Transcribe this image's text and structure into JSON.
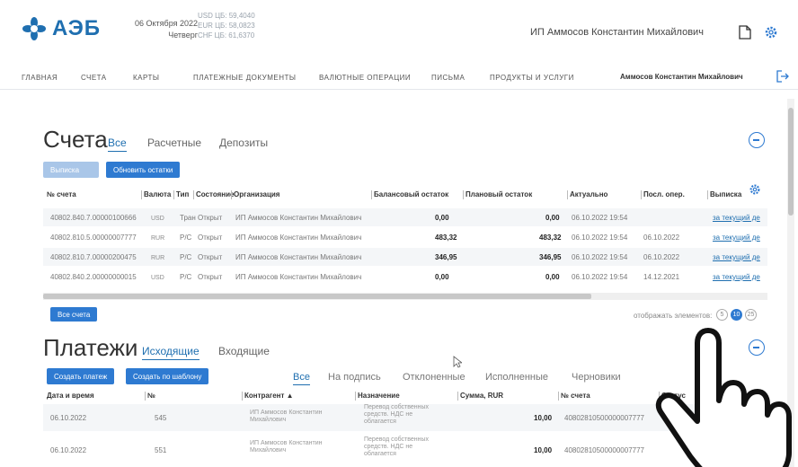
{
  "header": {
    "logo_text": "АЭБ",
    "date": "06 Октября 2022",
    "weekday": "Четверг",
    "rates": [
      "USD ЦБ: 59,4040",
      "EUR ЦБ: 58,0823",
      "CHF ЦБ: 61,6370"
    ],
    "user_name": "ИП Аммосов Константин Михайлович"
  },
  "nav": {
    "items": [
      "ГЛАВНАЯ",
      "СЧЕТА",
      "КАРТЫ",
      "ПЛАТЕЖНЫЕ ДОКУМЕНТЫ",
      "ВАЛЮТНЫЕ ОПЕРАЦИИ",
      "ПИСЬМА",
      "ПРОДУКТЫ И УСЛУГИ"
    ],
    "user_name": "Аммосов Константин Михайлович"
  },
  "accounts": {
    "title": "Счета",
    "tabs": [
      "Все",
      "Расчетные",
      "Депозиты"
    ],
    "buttons": {
      "first": "Выписка",
      "refresh": "Обновить остатки",
      "all": "Все счета"
    },
    "columns": [
      "№ счета",
      "Валюта",
      "Тип",
      "Состояние",
      "Организация",
      "Балансовый остаток",
      "Плановый остаток",
      "Актуально",
      "Посл. опер.",
      "Выписка"
    ],
    "rows": [
      {
        "number": "40802.840.7.00000100666",
        "currency": "USD",
        "type": "Тран",
        "state": "Открыт",
        "org": "ИП Аммосов Константин Михайлович",
        "balance": "0,00",
        "planned": "0,00",
        "actual": "06.10.2022 19:54",
        "last_op": "",
        "statement": "за текущий де"
      },
      {
        "number": "40802.810.5.00000007777",
        "currency": "RUR",
        "type": "Р/С",
        "state": "Открыт",
        "org": "ИП Аммосов Константин Михайлович",
        "balance": "483,32",
        "planned": "483,32",
        "actual": "06.10.2022 19:54",
        "last_op": "06.10.2022",
        "statement": "за текущий де"
      },
      {
        "number": "40802.810.7.00000200475",
        "currency": "RUR",
        "type": "Р/С",
        "state": "Открыт",
        "org": "ИП Аммосов Константин Михайлович",
        "balance": "346,95",
        "planned": "346,95",
        "actual": "06.10.2022 19:54",
        "last_op": "06.10.2022",
        "statement": "за текущий де"
      },
      {
        "number": "40802.840.2.00000000015",
        "currency": "USD",
        "type": "Р/С",
        "state": "Открыт",
        "org": "ИП Аммосов Константин Михайлович",
        "balance": "0,00",
        "planned": "0,00",
        "actual": "06.10.2022 19:54",
        "last_op": "14.12.2021",
        "statement": "за текущий де"
      }
    ],
    "show_label": "отображать элементов:",
    "page_sizes": [
      "5",
      "10",
      "25"
    ],
    "page_size_selected": "10"
  },
  "payments": {
    "title": "Платежи",
    "tabs": [
      "Исходящие",
      "Входящие"
    ],
    "buttons": {
      "create": "Создать платеж",
      "create_template": "Создать по шаблону"
    },
    "filters": [
      "Все",
      "На подпись",
      "Отклоненные",
      "Исполненные",
      "Черновики"
    ],
    "columns": [
      "Дата и время",
      "№",
      "Контрагент ▲",
      "Назначение",
      "Сумма, RUR",
      "№ счета",
      "Статус"
    ],
    "rows": [
      {
        "date": "06.10.2022",
        "number": "545",
        "counterparty": "ИП Аммосов Константин Михайлович",
        "purpose": "Перевод собственных средств. НДС не облагается",
        "amount": "10,00",
        "account": "40802810500000007777",
        "status": ""
      },
      {
        "date": "06.10.2022",
        "number": "551",
        "counterparty": "ИП Аммосов Константин Михайлович",
        "purpose": "Перевод собственных средств. НДС не облагается",
        "amount": "10,00",
        "account": "40802810500000007777",
        "status": ""
      }
    ]
  },
  "colors": {
    "brand": "#1f6fb0",
    "button": "#2e7ad1"
  }
}
